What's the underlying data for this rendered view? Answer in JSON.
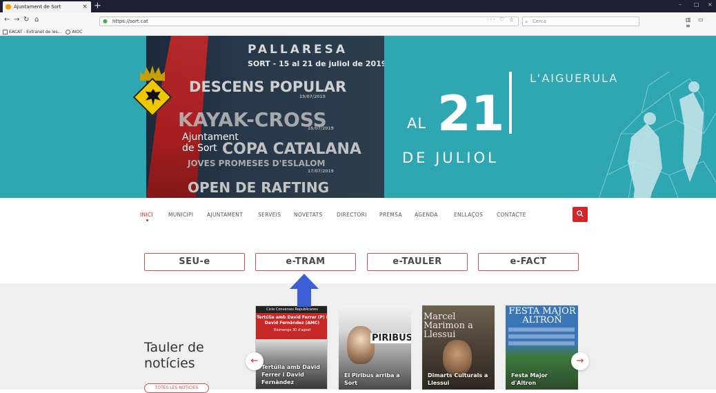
{
  "browser": {
    "tab_title": "Ajuntament de Sort",
    "tab_close": "×",
    "new_tab": "+",
    "url": "https://sort.cat",
    "search_placeholder": "Cerca",
    "bookmarks": [
      "EACAT - Extranet de les...",
      "AIOC"
    ],
    "window_controls": [
      "–",
      "□",
      "×"
    ]
  },
  "hero": {
    "poster": {
      "title": "PALLARESA",
      "subtitle": "SORT - 15 al 21 de juliol de 2019",
      "line1": "DESCENS POPULAR",
      "line1_date": "19/07/2019",
      "line2": "KAYAK-CROSS",
      "line2_date": "16/07/2019",
      "line3": "COPA CATALANA",
      "line4": "JOVES PROMESES D'ESLALOM",
      "line4_date": "17/07/2019",
      "line5": "OPEN DE RAFTING"
    },
    "brand_line1": "Ajuntament",
    "brand_line2": "de Sort",
    "date_al": "AL",
    "date_day": "21",
    "date_month": "DE JULIOL",
    "top_right": "L'AIGUERULA"
  },
  "nav": {
    "items": [
      "INICI",
      "MUNICIPI",
      "AJUNTAMENT",
      "SERVEIS",
      "NOVETATS",
      "DIRECTORI",
      "PREMSA",
      "AGENDA",
      "ENLLAÇOS",
      "CONTACTE"
    ],
    "active_index": 0,
    "search_icon": "search-icon"
  },
  "ebuttons": [
    "SEU-e",
    "e-TRAM",
    "e-TAULER",
    "e-FACT"
  ],
  "noticies": {
    "title_line1": "Tauler de",
    "title_line2": "notícies",
    "button": "TOTES LES NOTÍCIES",
    "prev": "←",
    "next": "→",
    "cards": [
      {
        "head": "Cicle Converses Republicanes",
        "red": "Tertúlia amb David Ferrer (P) i David Fernàndez (AMC)",
        "mid": "Diumenge 30 d'agost",
        "caption": "Tertúlia amb David Ferrer i David Fernàndez"
      },
      {
        "word": "PIRIBUS",
        "caption": "El Piribus arriba a Sort"
      },
      {
        "big": "Marcel Marimon a Llessui",
        "caption": "Dimarts Culturals a Llessui"
      },
      {
        "big": "FESTA MAJOR ALTRON",
        "caption": "Festa Major d'Altron"
      }
    ]
  },
  "colors": {
    "accent": "#d2262b",
    "hero_teal": "#2ea7b3",
    "gray_bg": "#efefef",
    "annotation_arrow": "#3c5fd6"
  }
}
